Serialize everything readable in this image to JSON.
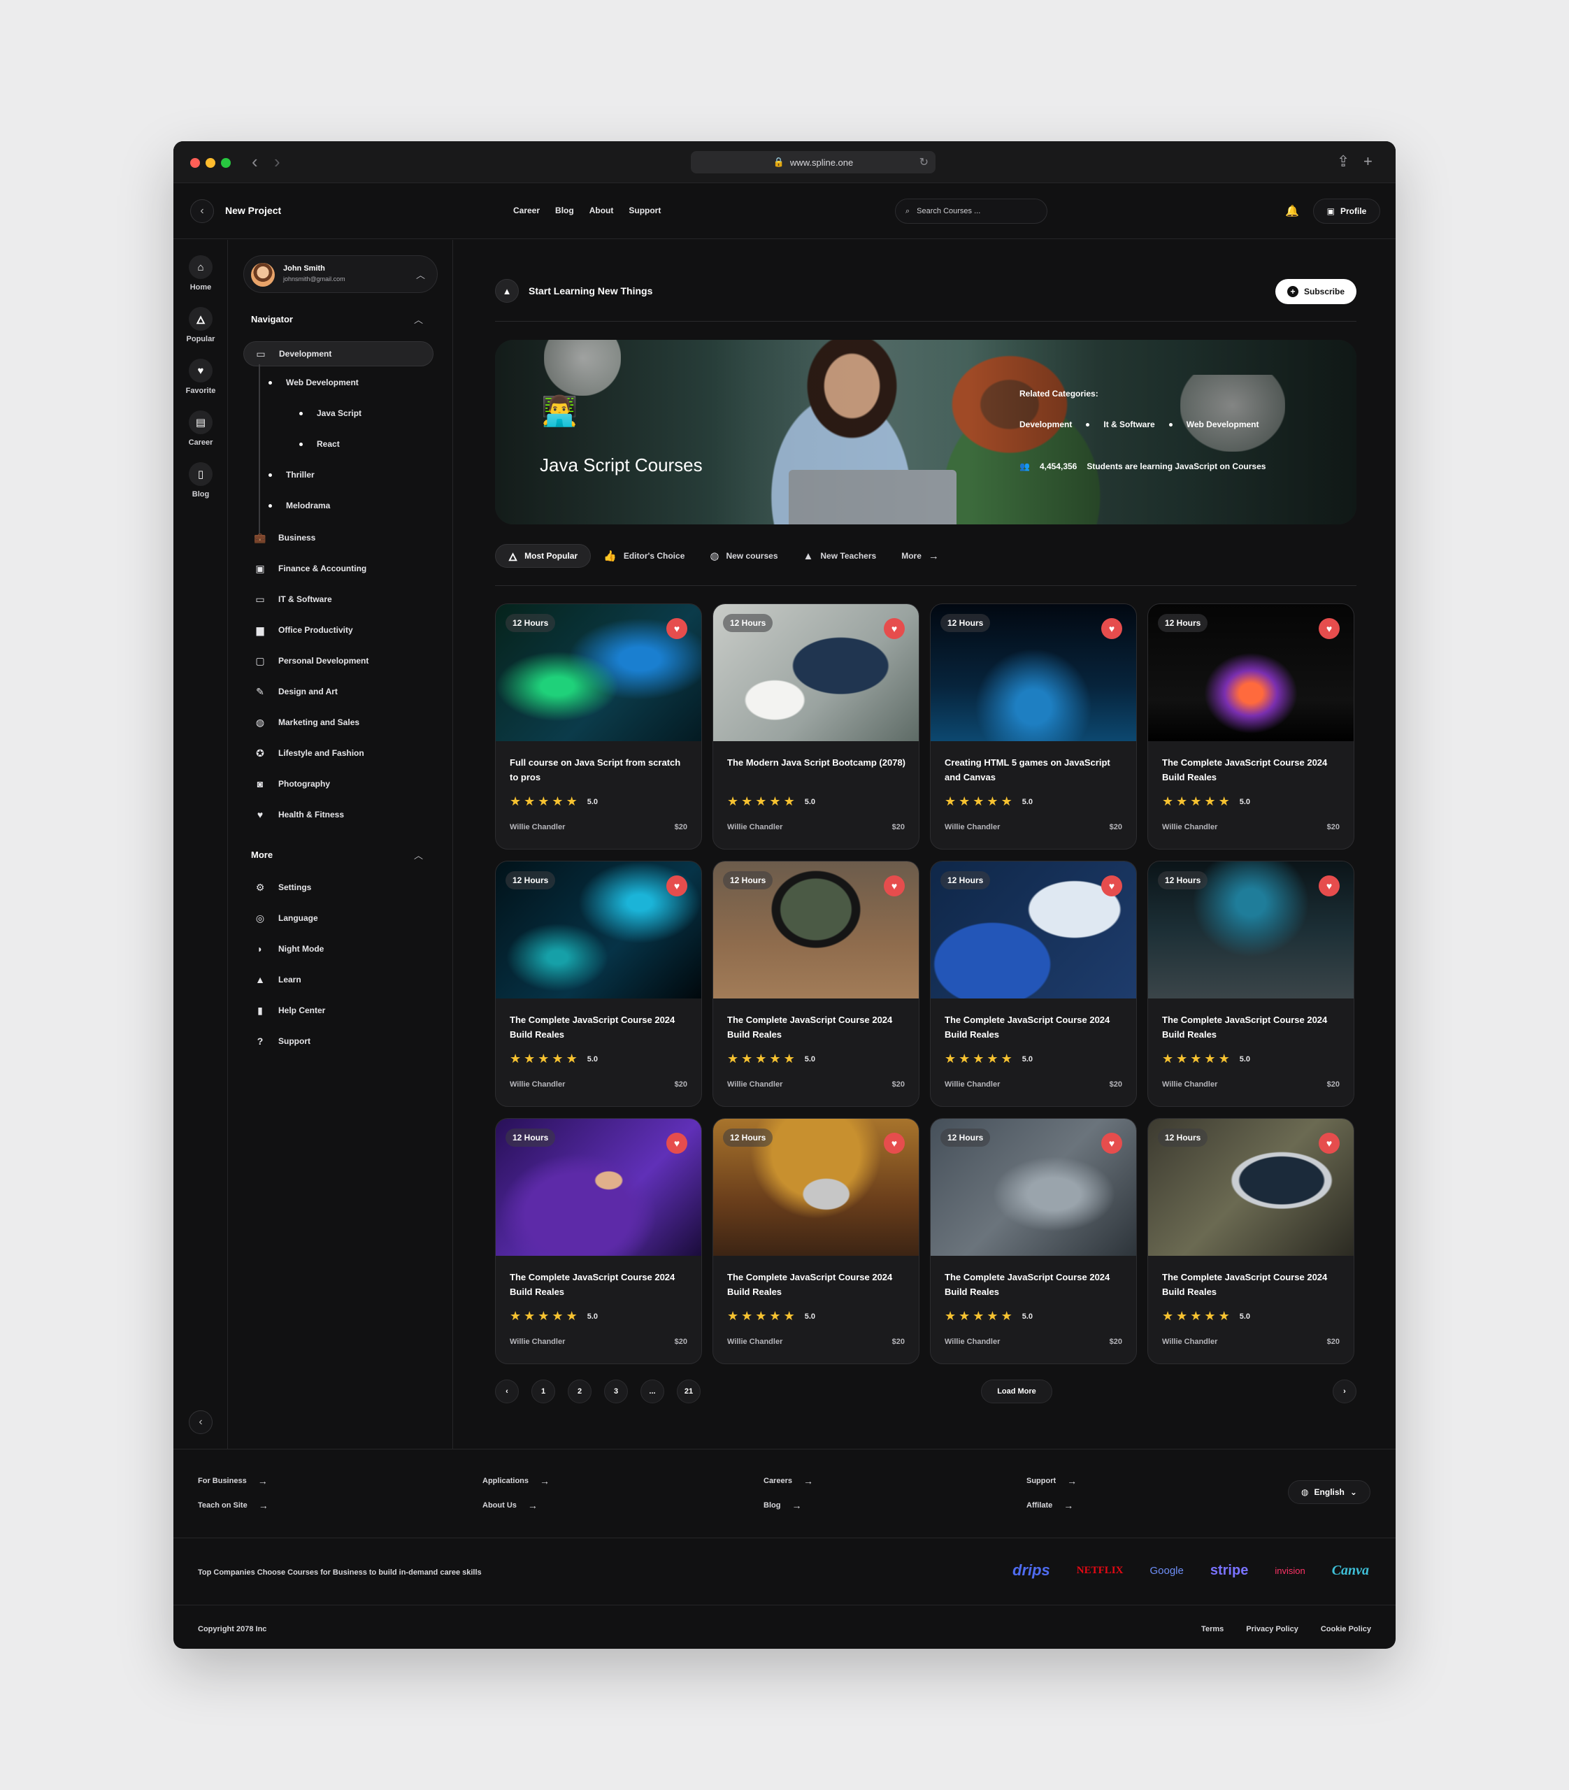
{
  "browser": {
    "url": "www.spline.one"
  },
  "topbar": {
    "project": "New Project",
    "nav": [
      "Career",
      "Blog",
      "About",
      "Support"
    ],
    "search_placeholder": "Search Courses ...",
    "profile_label": "Profile"
  },
  "rail": [
    {
      "label": "Home",
      "icon": "home-icon"
    },
    {
      "label": "Popular",
      "icon": "fire-icon"
    },
    {
      "label": "Favorite",
      "icon": "heart-icon"
    },
    {
      "label": "Career",
      "icon": "briefcase-icon"
    },
    {
      "label": "Blog",
      "icon": "document-icon"
    }
  ],
  "user": {
    "name": "John Smith",
    "email": "johnsmith@gmail.com"
  },
  "navigator": {
    "heading": "Navigator",
    "active": "Development",
    "subitems": [
      "Web Development",
      "Java Script",
      "React",
      "Thriller",
      "Melodrama"
    ],
    "categories": [
      "Business",
      "Finance & Accounting",
      "IT & Software",
      "Office Productivity",
      "Personal Development",
      "Design and Art",
      "Marketing and Sales",
      "Lifestyle and Fashion",
      "Photography",
      "Health & Fitness"
    ]
  },
  "more": {
    "heading": "More",
    "items": [
      "Settings",
      "Language",
      "Night Mode",
      "Learn",
      "Help Center",
      "Support"
    ]
  },
  "main": {
    "heading": "Start Learning New Things",
    "subscribe": "Subscribe"
  },
  "hero": {
    "title": "Java Script Courses",
    "related_label": "Related Categories:",
    "related": [
      "Development",
      "It & Software",
      "Web Development"
    ],
    "students_count": "4,454,356",
    "students_text": "Students are learning JavaScript on Courses"
  },
  "tabs": [
    "Most Popular",
    "Editor's Choice",
    "New courses",
    "New Teachers",
    "More"
  ],
  "courses": [
    {
      "hours": "12 Hours",
      "title": "Full course on Java Script from scratch to pros",
      "rating": "5.0",
      "author": "Willie Chandler",
      "price": "$20"
    },
    {
      "hours": "12 Hours",
      "title": "The Modern Java Script Bootcamp (2078)",
      "rating": "5.0",
      "author": "Willie Chandler",
      "price": "$20"
    },
    {
      "hours": "12 Hours",
      "title": "Creating HTML 5 games on JavaScript and Canvas",
      "rating": "5.0",
      "author": "Willie Chandler",
      "price": "$20"
    },
    {
      "hours": "12 Hours",
      "title": "The Complete JavaScript Course 2024 Build Reales",
      "rating": "5.0",
      "author": "Willie Chandler",
      "price": "$20"
    },
    {
      "hours": "12 Hours",
      "title": "The Complete JavaScript Course 2024 Build Reales",
      "rating": "5.0",
      "author": "Willie Chandler",
      "price": "$20"
    },
    {
      "hours": "12 Hours",
      "title": "The Complete JavaScript Course 2024 Build Reales",
      "rating": "5.0",
      "author": "Willie Chandler",
      "price": "$20"
    },
    {
      "hours": "12 Hours",
      "title": "The Complete JavaScript Course 2024 Build Reales",
      "rating": "5.0",
      "author": "Willie Chandler",
      "price": "$20"
    },
    {
      "hours": "12 Hours",
      "title": "The Complete JavaScript Course 2024 Build Reales",
      "rating": "5.0",
      "author": "Willie Chandler",
      "price": "$20"
    },
    {
      "hours": "12 Hours",
      "title": "The Complete JavaScript Course 2024 Build Reales",
      "rating": "5.0",
      "author": "Willie Chandler",
      "price": "$20"
    },
    {
      "hours": "12 Hours",
      "title": "The Complete JavaScript Course 2024 Build Reales",
      "rating": "5.0",
      "author": "Willie Chandler",
      "price": "$20"
    },
    {
      "hours": "12 Hours",
      "title": "The Complete JavaScript Course 2024 Build Reales",
      "rating": "5.0",
      "author": "Willie Chandler",
      "price": "$20"
    },
    {
      "hours": "12 Hours",
      "title": "The Complete JavaScript Course 2024 Build Reales",
      "rating": "5.0",
      "author": "Willie Chandler",
      "price": "$20"
    }
  ],
  "pagination": {
    "pages": [
      "1",
      "2",
      "3",
      "...",
      "21"
    ],
    "load_more": "Load More"
  },
  "footer": {
    "links": [
      [
        "For Business",
        "Teach on Site"
      ],
      [
        "Applications",
        "About Us"
      ],
      [
        "Careers",
        "Blog"
      ],
      [
        "Support",
        "Affilate"
      ]
    ],
    "language": "English",
    "tagline": "Top Companies Choose Courses for Business to build in-demand caree skills",
    "logos": [
      "drips",
      "NETFLIX",
      "Google",
      "stripe",
      "invision",
      "Canva"
    ],
    "copyright": "Copyright 2078 Inc",
    "legal": [
      "Terms",
      "Privacy Policy",
      "Cookie Policy"
    ]
  },
  "colors": {
    "accent_heart": "#e64d4d",
    "star": "#f6c231",
    "background": "#111112"
  }
}
